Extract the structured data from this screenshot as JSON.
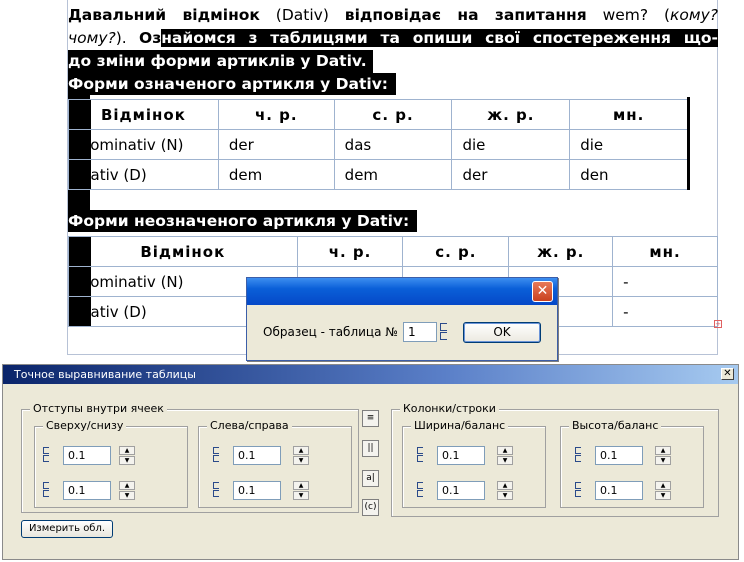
{
  "document": {
    "paragraph": {
      "line1": {
        "a": "Давальний відмінок",
        "b": " (Dativ) ",
        "c": "відповідає на запитання",
        "d": " wem? (",
        "e": "кому?"
      },
      "line2": {
        "a": "чому?",
        "b": "). ",
        "c": "Оз",
        "d": "найомся з таблицями та опиши свої спостереження що-"
      },
      "line3": "до зміни форми артиклів у Dativ."
    },
    "heading_definite": "Форми означеного артикля у Dativ:",
    "heading_indefinite": "Форми неозначеного артикля у Dativ:",
    "table_definite": {
      "headers": [
        "Відмінок",
        "ч. р.",
        "с. р.",
        "ж. р.",
        "мн."
      ],
      "rows": [
        [
          "Nominativ  (N)",
          "der",
          "das",
          "die",
          "die"
        ],
        [
          "Dativ  (D)",
          "dem",
          "dem",
          "der",
          "den"
        ]
      ]
    },
    "table_indefinite": {
      "headers": [
        "Відмінок",
        "ч. р.",
        "с. р.",
        "ж. р.",
        "мн."
      ],
      "rows": [
        [
          "Nominativ  (N)",
          "",
          "",
          "",
          "-"
        ],
        [
          "Dativ  (D)",
          "",
          "",
          "",
          "-"
        ]
      ]
    }
  },
  "small_dialog": {
    "label": "Образец - таблица №",
    "value": "1",
    "ok_label": "OK",
    "close_glyph": "✕"
  },
  "align_dialog": {
    "title": "Точное выравнивание таблицы",
    "close_glyph": "✕",
    "group_padding": {
      "label": "Отступы внутри ячеек",
      "sub_top_bottom": {
        "label": "Сверху/снизу",
        "values": [
          "0.1",
          "0.1"
        ]
      },
      "sub_left_right": {
        "label": "Слева/справа",
        "values": [
          "0.1",
          "0.1"
        ]
      }
    },
    "group_colsrows": {
      "label": "Колонки/строки",
      "sub_width": {
        "label": "Ширина/баланс",
        "values": [
          "0.1",
          "0.1"
        ]
      },
      "sub_height": {
        "label": "Высота/баланс",
        "values": [
          "0.1",
          "0.1"
        ]
      }
    },
    "middle_icons": [
      "≡",
      "||",
      "a|",
      "(c)"
    ],
    "measure_label": "Измерить обл.",
    "spin_up": "▲",
    "spin_down": "▼"
  },
  "colors": {
    "titlebar_blue": "#0a5fd8",
    "dialog_bg": "#ece9d8",
    "table_border": "#9fb3cf",
    "close_red": "#c9401e"
  }
}
